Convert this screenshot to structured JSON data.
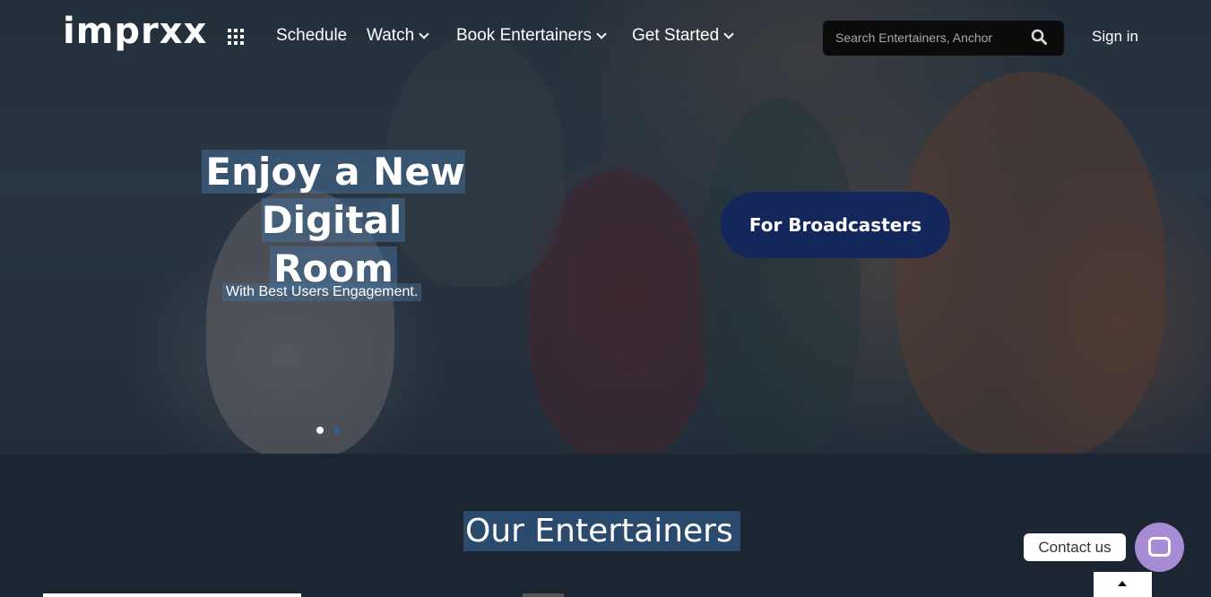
{
  "brand": {
    "logo_text": "imprxx"
  },
  "nav": {
    "apps_icon": "grid-icon",
    "items": [
      {
        "label": "Schedule",
        "has_dropdown": false
      },
      {
        "label": "Watch",
        "has_dropdown": true
      },
      {
        "label": "Book Entertainers",
        "has_dropdown": true
      },
      {
        "label": "Get Started",
        "has_dropdown": true
      }
    ],
    "search": {
      "placeholder": "Search Entertainers, Anchor",
      "icon": "search-icon"
    },
    "signin_label": "Sign in"
  },
  "hero": {
    "headline_line1": "Enjoy a New Digital",
    "headline_line2": "Room",
    "subheadline": "With Best Users Engagement.",
    "cta_label": "For Broadcasters",
    "slides": {
      "active": 1,
      "count": 2
    }
  },
  "section": {
    "title": "Our Entertainers"
  },
  "contact": {
    "label": "Contact us",
    "icon": "chat-icon"
  },
  "scroll_top": {
    "icon": "arrow-up-icon"
  },
  "colors": {
    "page_bg": "#1c2633",
    "cta_bg": "#13275a",
    "contact_bg": "#a78bd3",
    "highlight": "#2b4b6e"
  }
}
